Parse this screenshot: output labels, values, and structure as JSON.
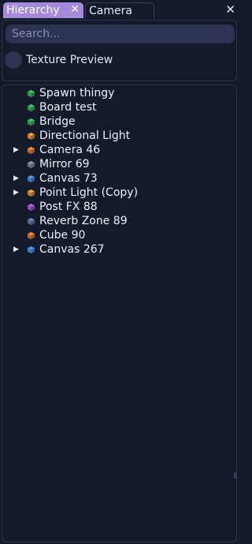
{
  "tabs": [
    {
      "label": "Hierarchy",
      "active": true
    },
    {
      "label": "Camera",
      "active": false
    }
  ],
  "search": {
    "placeholder": "Search..."
  },
  "preview": {
    "label": "Texture Preview"
  },
  "tree": [
    {
      "label": "Spawn thingy",
      "icon_color": "#3fbf5a",
      "expandable": false
    },
    {
      "label": "Board test",
      "icon_color": "#3fbf5a",
      "expandable": false
    },
    {
      "label": "Bridge",
      "icon_color": "#3fbf5a",
      "expandable": false
    },
    {
      "label": "Directional Light",
      "icon_color": "#f0a030",
      "expandable": false
    },
    {
      "label": "Camera 46",
      "icon_color": "#f08a30",
      "expandable": true
    },
    {
      "label": "Mirror 69",
      "icon_color": "#8a96b0",
      "expandable": false
    },
    {
      "label": "Canvas 73",
      "icon_color": "#4a9ae8",
      "expandable": true
    },
    {
      "label": "Point Light (Copy)",
      "icon_color": "#f0a030",
      "expandable": true
    },
    {
      "label": "Post FX 88",
      "icon_color": "#b060d8",
      "expandable": false
    },
    {
      "label": "Reverb Zone 89",
      "icon_color": "#7080a8",
      "expandable": false
    },
    {
      "label": "Cube 90",
      "icon_color": "#f08a30",
      "expandable": false
    },
    {
      "label": "Canvas 267",
      "icon_color": "#4a9ae8",
      "expandable": true
    }
  ],
  "colors": {
    "background": "#141a2b",
    "accent": "#a48ad8",
    "field": "#2d3350"
  }
}
